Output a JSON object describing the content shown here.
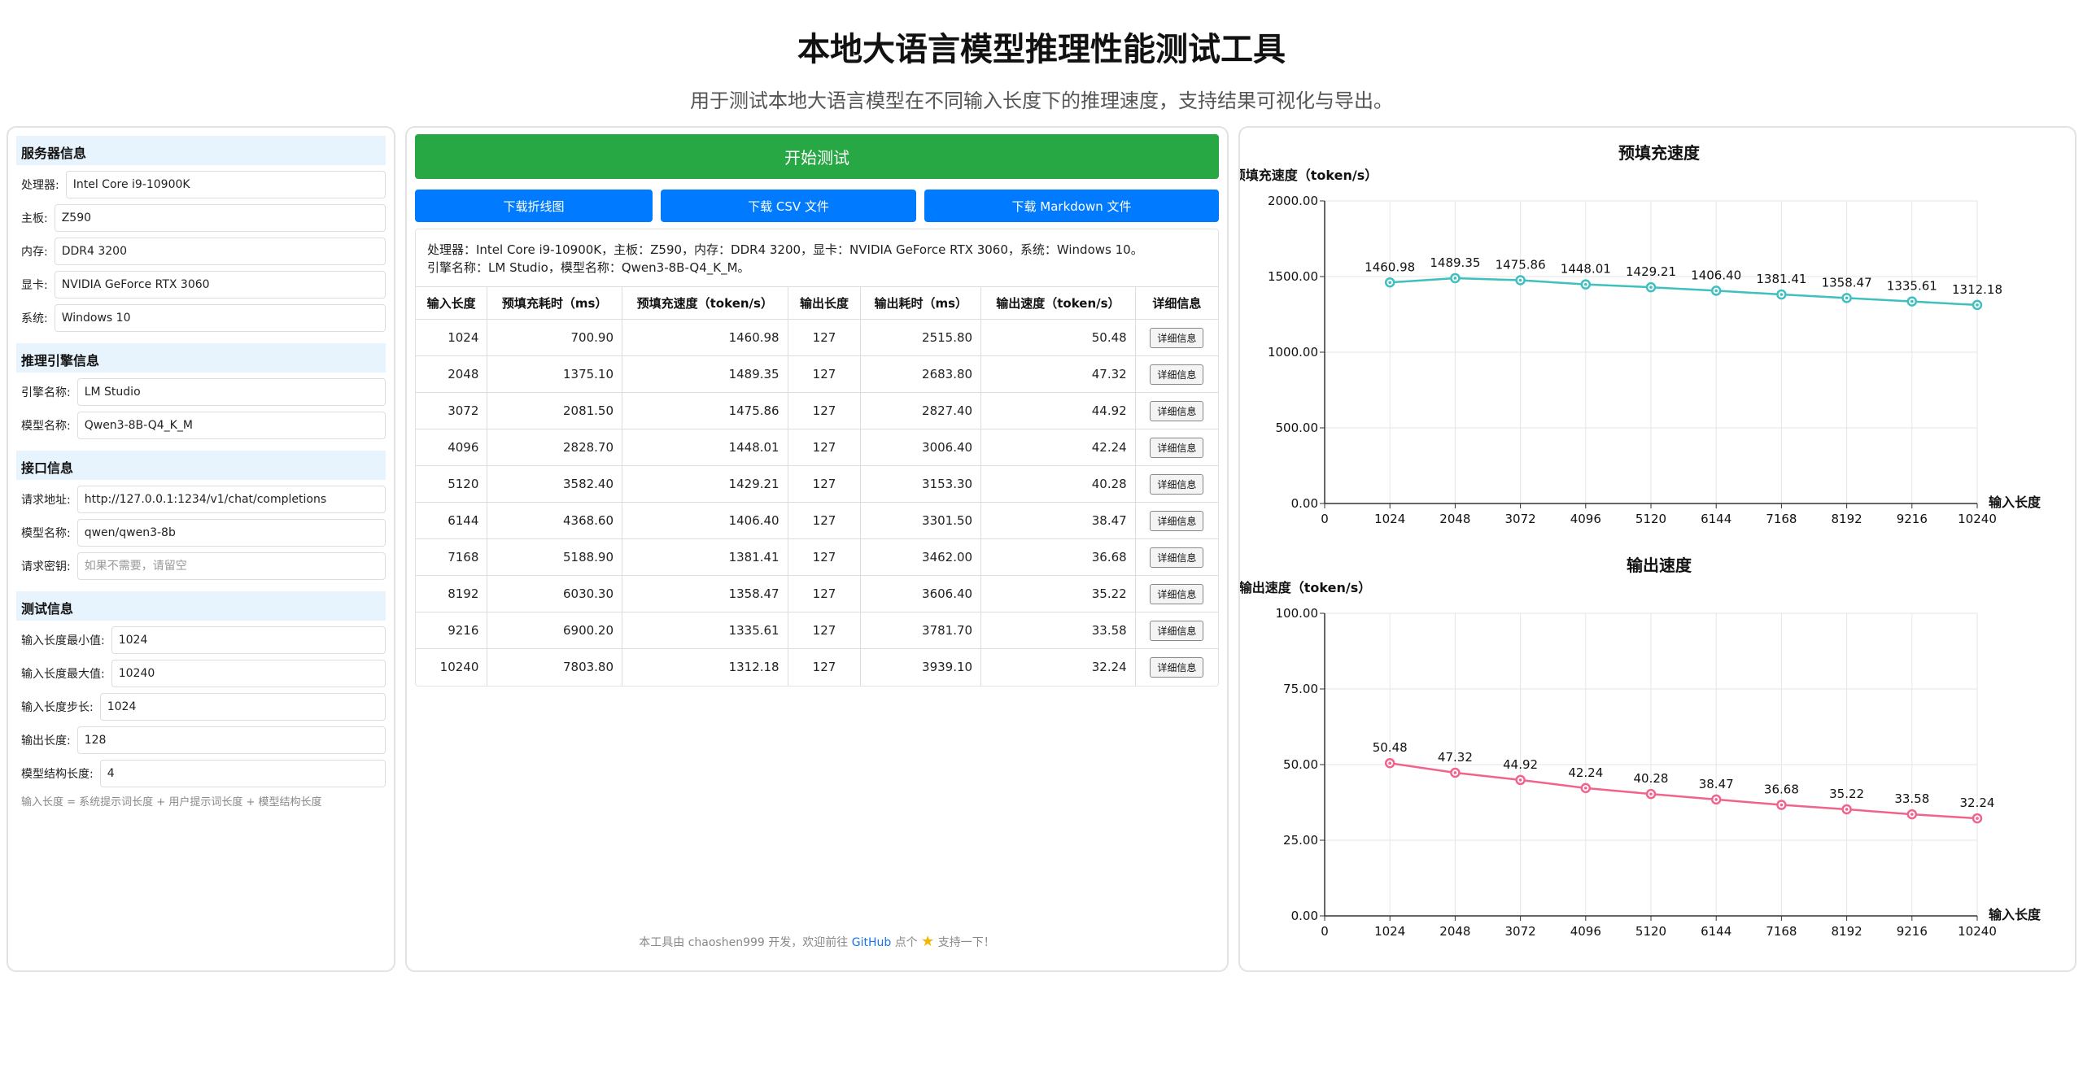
{
  "header": {
    "title": "本地大语言模型推理性能测试工具",
    "subtitle": "用于测试本地大语言模型在不同输入长度下的推理速度，支持结果可视化与导出。"
  },
  "left": {
    "server_section": "服务器信息",
    "server_fields": [
      {
        "label": "处理器:",
        "value": "Intel Core i9-10900K"
      },
      {
        "label": "主板:",
        "value": "Z590"
      },
      {
        "label": "内存:",
        "value": "DDR4 3200"
      },
      {
        "label": "显卡:",
        "value": "NVIDIA GeForce RTX 3060"
      },
      {
        "label": "系统:",
        "value": "Windows 10"
      }
    ],
    "engine_section": "推理引擎信息",
    "engine_fields": [
      {
        "label": "引擎名称:",
        "value": "LM Studio"
      },
      {
        "label": "模型名称:",
        "value": "Qwen3-8B-Q4_K_M"
      }
    ],
    "api_section": "接口信息",
    "api_fields": [
      {
        "label": "请求地址:",
        "value": "http://127.0.0.1:1234/v1/chat/completions"
      },
      {
        "label": "模型名称:",
        "value": "qwen/qwen3-8b"
      },
      {
        "label": "请求密钥:",
        "value": "",
        "placeholder": "如果不需要，请留空"
      }
    ],
    "test_section": "测试信息",
    "test_fields": [
      {
        "label": "输入长度最小值:",
        "value": "1024"
      },
      {
        "label": "输入长度最大值:",
        "value": "10240"
      },
      {
        "label": "输入长度步长:",
        "value": "1024"
      },
      {
        "label": "输出长度:",
        "value": "128"
      },
      {
        "label": "模型结构长度:",
        "value": "4"
      }
    ],
    "hint": "输入长度 = 系统提示词长度 + 用户提示词长度 + 模型结构长度"
  },
  "middle": {
    "start_button": "开始测试",
    "download_chart": "下载折线图",
    "download_csv": "下载 CSV 文件",
    "download_md": "下载 Markdown 文件",
    "sysinfo_line1": "处理器：Intel Core i9-10900K，主板：Z590，内存：DDR4 3200，显卡：NVIDIA GeForce RTX 3060，系统：Windows 10。",
    "sysinfo_line2": "引擎名称：LM Studio，模型名称：Qwen3-8B-Q4_K_M。",
    "columns": [
      "输入长度",
      "预填充耗时（ms）",
      "预填充速度（token/s）",
      "输出长度",
      "输出耗时（ms）",
      "输出速度（token/s）",
      "详细信息"
    ],
    "detail_label": "详细信息",
    "rows": [
      [
        "1024",
        "700.90",
        "1460.98",
        "127",
        "2515.80",
        "50.48"
      ],
      [
        "2048",
        "1375.10",
        "1489.35",
        "127",
        "2683.80",
        "47.32"
      ],
      [
        "3072",
        "2081.50",
        "1475.86",
        "127",
        "2827.40",
        "44.92"
      ],
      [
        "4096",
        "2828.70",
        "1448.01",
        "127",
        "3006.40",
        "42.24"
      ],
      [
        "5120",
        "3582.40",
        "1429.21",
        "127",
        "3153.30",
        "40.28"
      ],
      [
        "6144",
        "4368.60",
        "1406.40",
        "127",
        "3301.50",
        "38.47"
      ],
      [
        "7168",
        "5188.90",
        "1381.41",
        "127",
        "3462.00",
        "36.68"
      ],
      [
        "8192",
        "6030.30",
        "1358.47",
        "127",
        "3606.40",
        "35.22"
      ],
      [
        "9216",
        "6900.20",
        "1335.61",
        "127",
        "3781.70",
        "33.58"
      ],
      [
        "10240",
        "7803.80",
        "1312.18",
        "127",
        "3939.10",
        "32.24"
      ]
    ],
    "footer_prefix": "本工具由 chaoshen999 开发，欢迎前往",
    "footer_link": "GitHub",
    "footer_mid": "点个",
    "footer_suffix": "支持一下！"
  },
  "chart_data": [
    {
      "type": "line",
      "title": "预填充速度",
      "ylabel": "预填充速度（token/s）",
      "xlabel": "输入长度",
      "x": [
        1024,
        2048,
        3072,
        4096,
        5120,
        6144,
        7168,
        8192,
        9216,
        10240
      ],
      "xticks": [
        0,
        1024,
        2048,
        3072,
        4096,
        5120,
        6144,
        7168,
        8192,
        9216,
        10240
      ],
      "values": [
        1460.98,
        1489.35,
        1475.86,
        1448.01,
        1429.21,
        1406.4,
        1381.41,
        1358.47,
        1335.61,
        1312.18
      ],
      "yticks": [
        "0.00",
        "500.00",
        "1000.00",
        "1500.00",
        "2000.00"
      ],
      "ylim": [
        0,
        2000
      ],
      "color": "#3fbfbf",
      "grid": true
    },
    {
      "type": "line",
      "title": "输出速度",
      "ylabel": "输出速度（token/s）",
      "xlabel": "输入长度",
      "x": [
        1024,
        2048,
        3072,
        4096,
        5120,
        6144,
        7168,
        8192,
        9216,
        10240
      ],
      "xticks": [
        0,
        1024,
        2048,
        3072,
        4096,
        5120,
        6144,
        7168,
        8192,
        9216,
        10240
      ],
      "values": [
        50.48,
        47.32,
        44.92,
        42.24,
        40.28,
        38.47,
        36.68,
        35.22,
        33.58,
        32.24
      ],
      "yticks": [
        "0.00",
        "25.00",
        "50.00",
        "75.00",
        "100.00"
      ],
      "ylim": [
        0,
        100
      ],
      "color": "#f0648c",
      "grid": true
    }
  ]
}
